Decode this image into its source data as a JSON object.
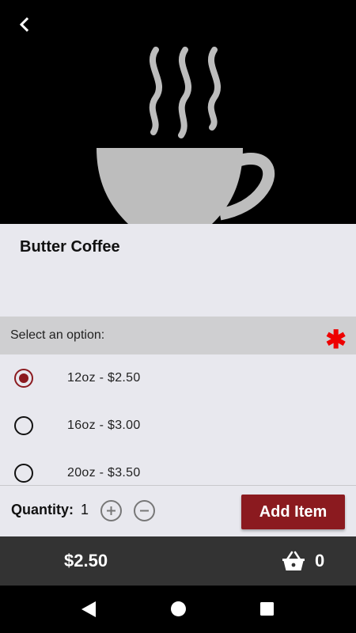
{
  "product": {
    "title": "Butter Coffee"
  },
  "options": {
    "header": "Select an option:",
    "required_mark": "✱",
    "items": [
      {
        "label": "12oz - $2.50",
        "selected": true
      },
      {
        "label": "16oz - $3.00",
        "selected": false
      },
      {
        "label": "20oz - $3.50",
        "selected": false
      }
    ]
  },
  "quantity": {
    "label": "Quantity:",
    "value": "1"
  },
  "actions": {
    "add_item": "Add Item"
  },
  "cart": {
    "total": "$2.50",
    "count": "0"
  },
  "icons": {
    "back": "chevron-left-icon",
    "hero": "coffee-cup-icon",
    "plus": "plus-circle-icon",
    "minus": "minus-circle-icon",
    "basket": "basket-icon",
    "nav_back": "triangle-back-icon",
    "nav_home": "circle-home-icon",
    "nav_recents": "square-recents-icon"
  },
  "colors": {
    "accent": "#8b1a1f",
    "required": "#ee0000",
    "cart_bar": "#333333",
    "panel": "#e8e8ee",
    "header": "#cfcfd1"
  }
}
